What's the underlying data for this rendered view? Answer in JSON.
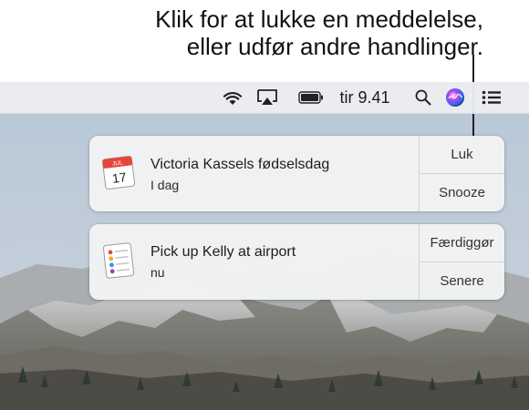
{
  "callout": {
    "line1": "Klik for at lukke en meddelelse,",
    "line2": "eller udfør andre handlinger."
  },
  "menubar": {
    "time": "tir 9.41",
    "icons": [
      "wifi-icon",
      "airplay-icon",
      "battery-icon",
      "spotlight-search-icon",
      "siri-icon",
      "notification-center-icon"
    ]
  },
  "notifications": [
    {
      "app": "calendar",
      "icon_month": "JUL",
      "icon_day": "17",
      "title": "Victoria Kassels fødselsdag",
      "subtitle": "I dag",
      "actions": [
        "Luk",
        "Snooze"
      ]
    },
    {
      "app": "reminders",
      "title": "Pick up Kelly at airport",
      "subtitle": "nu",
      "actions": [
        "Færdiggør",
        "Senere"
      ]
    }
  ],
  "colors": {
    "calendar_red": "#e8453c",
    "siri_gradient": [
      "#2b6df5",
      "#c43ee6",
      "#ff3b6b"
    ]
  }
}
